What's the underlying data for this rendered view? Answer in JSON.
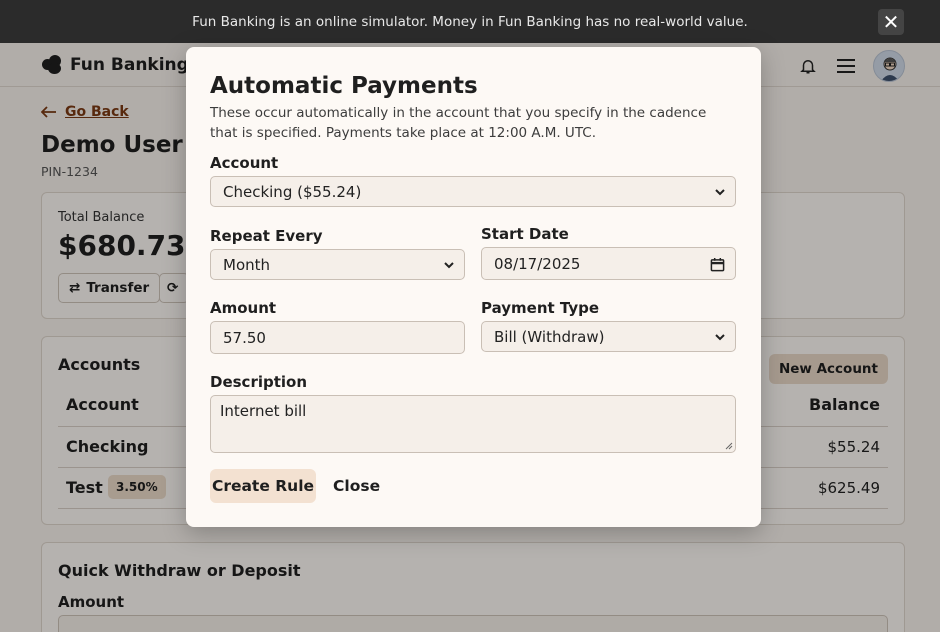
{
  "notice": {
    "text": "Fun Banking is an online simulator. Money in Fun Banking has no real-world value."
  },
  "header": {
    "brand": "Fun Banking"
  },
  "page": {
    "back_label": "Go Back",
    "user_name": "Demo User",
    "pin": "PIN-1234",
    "total_balance_label": "Total Balance",
    "total_balance": "$680.73",
    "transfer_label": "Transfer"
  },
  "accounts": {
    "title": "Accounts",
    "new_account_label": "New Account",
    "col_account": "Account",
    "col_balance": "Balance",
    "rows": [
      {
        "name": "Checking",
        "badge": "",
        "balance": "$55.24"
      },
      {
        "name": "Test",
        "badge": "3.50%",
        "balance": "$625.49"
      }
    ]
  },
  "quick": {
    "title": "Quick Withdraw or Deposit",
    "amount_label": "Amount"
  },
  "modal": {
    "title": "Automatic Payments",
    "description": "These occur automatically in the account that you specify in the cadence that is specified. Payments take place at 12:00 A.M. UTC.",
    "account_label": "Account",
    "account_value": "Checking ($55.24)",
    "repeat_label": "Repeat Every",
    "repeat_value": "Month",
    "start_label": "Start Date",
    "start_value": "08/17/2025",
    "amount_label": "Amount",
    "amount_value": "57.50",
    "type_label": "Payment Type",
    "type_value": "Bill (Withdraw)",
    "desc_label": "Description",
    "desc_value": "Internet bill",
    "create_label": "Create Rule",
    "close_label": "Close"
  },
  "colors": {
    "overlay": "#00000047",
    "accent_link": "#7a3a14",
    "button_soft": "#f3e1d1"
  }
}
